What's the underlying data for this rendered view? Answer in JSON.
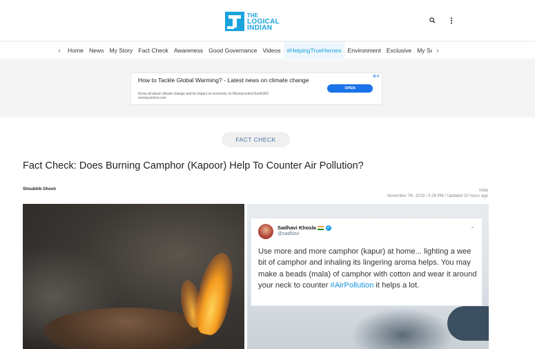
{
  "brand": {
    "line1": "THE",
    "line2": "LOGICAL",
    "line3": "INDIAN",
    "color": "#1aa3dd"
  },
  "header": {
    "search_icon": "search-icon",
    "menu_icon": "more-vertical-icon"
  },
  "nav": {
    "prev": "‹",
    "next": "›",
    "items": [
      "Home",
      "News",
      "My Story",
      "Fact Check",
      "Awareness",
      "Good Governance",
      "Videos",
      "#HelpingTrueHeroes",
      "Environment",
      "Exclusive",
      "My Soc"
    ]
  },
  "ad": {
    "title": "How to Tackle Global Warming? - Latest news on climate change",
    "description": "Know all about climate change and its impact on economy on Moneycontrol Earth360",
    "domain": "moneycontrol.com",
    "button": "OPEN",
    "close": "⊗✕"
  },
  "article": {
    "category": "FACT CHECK",
    "title": "Fact Check: Does Burning Camphor (Kapoor) Help To Counter Air Pollution?",
    "author": "Shoubhik Ghosh",
    "location": "India",
    "date": "November 7th, 2019 / 5:26 PM / Updated 20 hours ago"
  },
  "tweet": {
    "name": "Sadhavi Khosla",
    "handle": "@sadhavi",
    "text_before": "Use more and more camphor (kapur) at home... lighting a wee bit of camphor and inhaling its lingering aroma helps. You may make a beads (mala) of camphor with cotton and wear it around your neck to counter ",
    "hashtag": "#AirPollution",
    "text_after": " it helps a lot."
  }
}
